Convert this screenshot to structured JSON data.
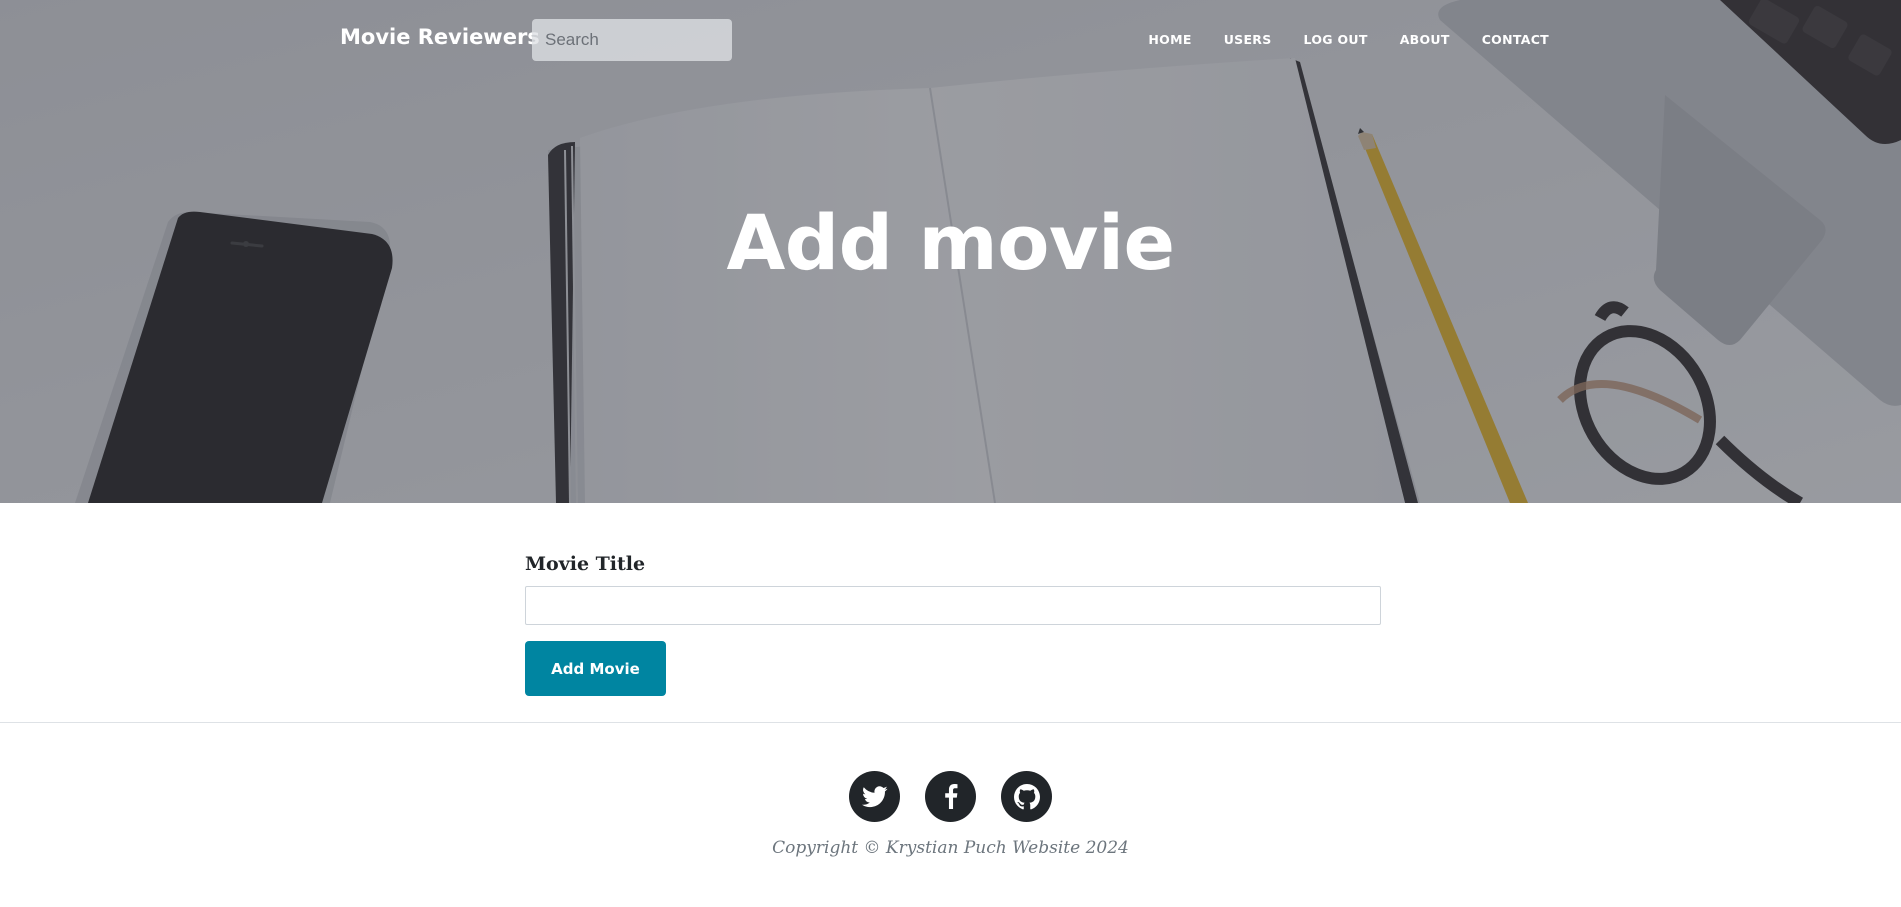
{
  "navbar": {
    "brand": "Movie Reviewers",
    "search_placeholder": "Search",
    "links": [
      "HOME",
      "USERS",
      "LOG OUT",
      "ABOUT",
      "CONTACT"
    ]
  },
  "hero": {
    "heading": "Add movie"
  },
  "form": {
    "title_label": "Movie Title",
    "title_value": "",
    "submit_label": "Add Movie"
  },
  "footer": {
    "social_icons": [
      "twitter-icon",
      "facebook-icon",
      "github-icon"
    ],
    "copyright": "Copyright © Krystian Puch Website 2024"
  },
  "colors": {
    "accent": "#0085a1",
    "social_bg": "#212529",
    "hero_overlay": "#3c3f48"
  }
}
